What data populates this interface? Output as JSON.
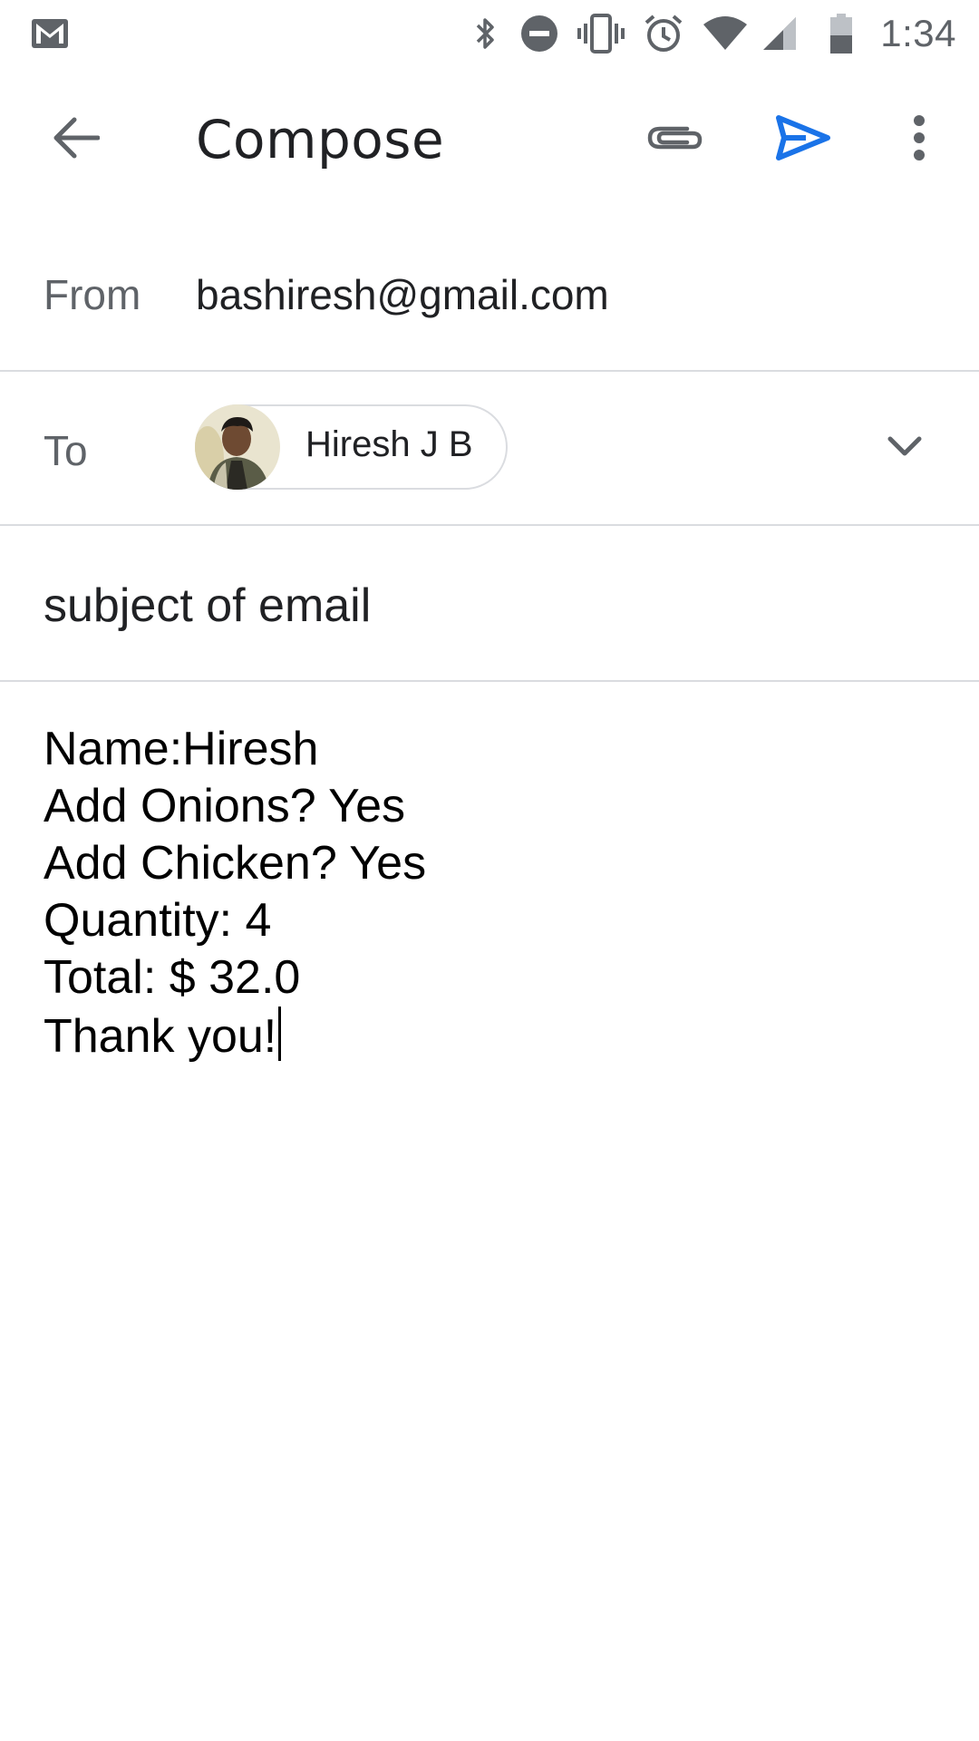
{
  "status_bar": {
    "time": "1:34",
    "icons": [
      "gmail-notification-icon",
      "bluetooth-icon",
      "do-not-disturb-icon",
      "vibrate-icon",
      "alarm-icon",
      "wifi-icon",
      "cellular-signal-icon",
      "battery-icon"
    ]
  },
  "app_bar": {
    "title": "Compose",
    "icons": [
      "back-arrow-icon",
      "attach-icon",
      "send-icon",
      "more-vert-icon"
    ],
    "accent_color": "#1a73e8"
  },
  "from": {
    "label": "From",
    "value": "bashiresh@gmail.com"
  },
  "to": {
    "label": "To",
    "recipient_chip": "Hiresh J B",
    "expand_icon": "chevron-down-icon"
  },
  "subject": {
    "value": "subject of email"
  },
  "body": {
    "lines": [
      "Name:Hiresh",
      "Add Onions? Yes",
      "Add Chicken? Yes",
      "Quantity: 4",
      "Total: $ 32.0",
      "Thank you!"
    ]
  }
}
